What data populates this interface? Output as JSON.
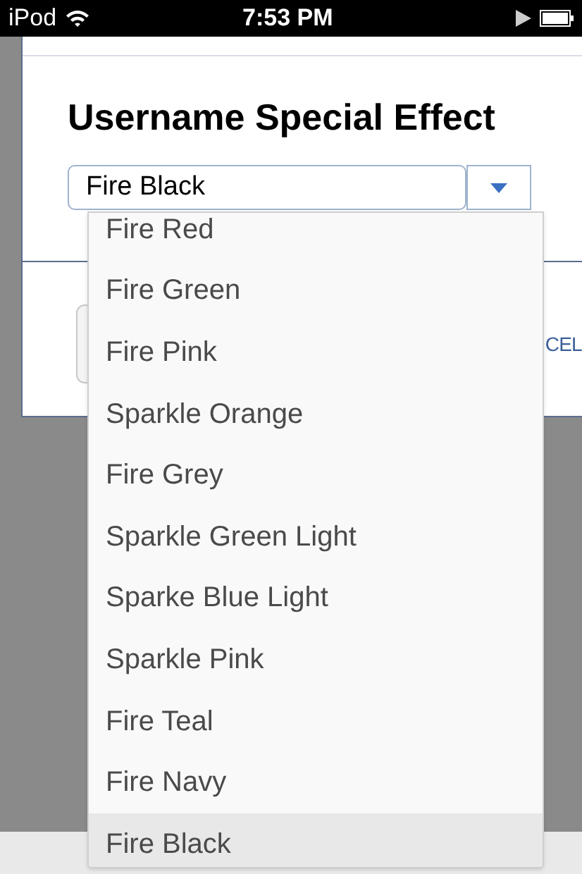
{
  "status_bar": {
    "carrier": "iPod",
    "time": "7:53 PM"
  },
  "dialog": {
    "title": "Username Special Effect",
    "select_value": "Fire Black",
    "partial_button_text": "CEL"
  },
  "dropdown": {
    "options": [
      {
        "label": "Fire Red",
        "selected": false
      },
      {
        "label": "Fire Green",
        "selected": false
      },
      {
        "label": "Fire Pink",
        "selected": false
      },
      {
        "label": "Sparkle Orange",
        "selected": false
      },
      {
        "label": "Fire Grey",
        "selected": false
      },
      {
        "label": "Sparkle Green Light",
        "selected": false
      },
      {
        "label": "Sparke Blue Light",
        "selected": false
      },
      {
        "label": "Sparkle Pink",
        "selected": false
      },
      {
        "label": "Fire Teal",
        "selected": false
      },
      {
        "label": "Fire Navy",
        "selected": false
      },
      {
        "label": "Fire Black",
        "selected": true
      }
    ]
  }
}
